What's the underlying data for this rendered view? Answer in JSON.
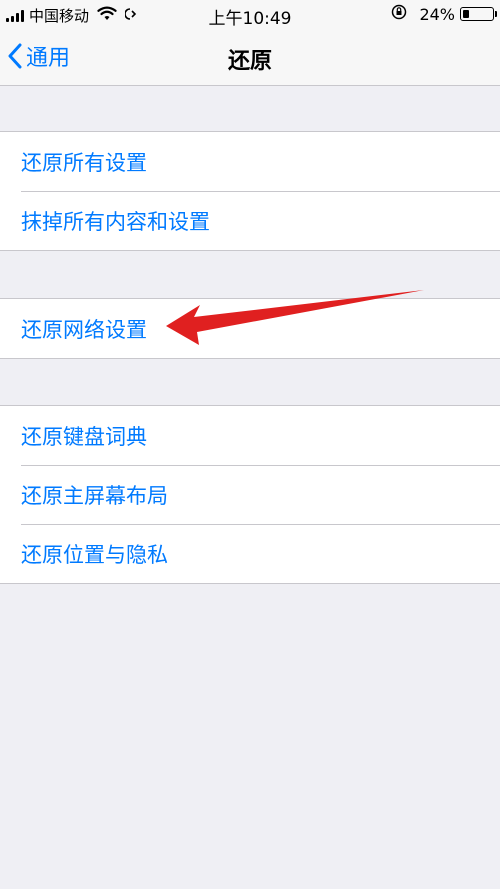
{
  "status_bar": {
    "carrier": "中国移动",
    "time": "上午10:49",
    "battery_percent": "24%",
    "battery_level": 0.24
  },
  "nav": {
    "back_label": "通用",
    "title": "还原"
  },
  "groups": [
    {
      "items": [
        {
          "label": "还原所有设置"
        },
        {
          "label": "抹掉所有内容和设置"
        }
      ]
    },
    {
      "items": [
        {
          "label": "还原网络设置"
        }
      ]
    },
    {
      "items": [
        {
          "label": "还原键盘词典"
        },
        {
          "label": "还原主屏幕布局"
        },
        {
          "label": "还原位置与隐私"
        }
      ]
    }
  ],
  "annotation": {
    "color": "#e02020",
    "target": "还原网络设置"
  },
  "colors": {
    "accent": "#007aff",
    "background": "#efeff4",
    "separator": "#c8c7cc"
  }
}
